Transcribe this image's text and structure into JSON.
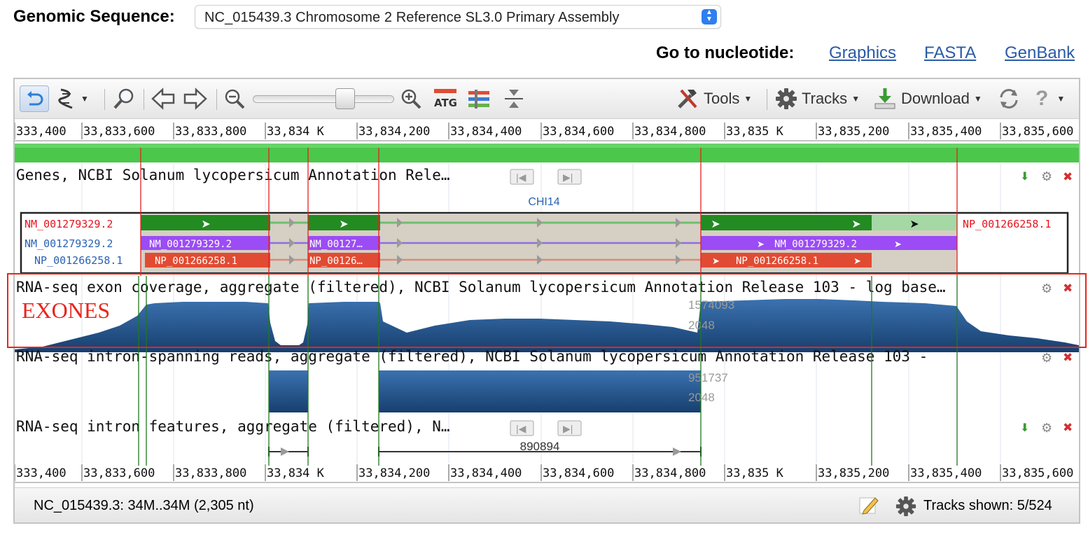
{
  "header": {
    "sequence_label": "Genomic Sequence:",
    "sequence_value": "NC_015439.3 Chromosome 2 Reference SL3.0 Primary Assembly",
    "goto_label": "Go to nucleotide:",
    "links": [
      "Graphics",
      "FASTA",
      "GenBank"
    ]
  },
  "toolbar": {
    "tools_label": "Tools",
    "tracks_label": "Tracks",
    "download_label": "Download",
    "zoom_level": 0.68
  },
  "ruler": {
    "ticks": [
      "33,833,400",
      "33,833,600",
      "33,833,800",
      "33,834 K",
      "33,834,200",
      "33,834,400",
      "33,834,600",
      "33,834,800",
      "33,835 K",
      "33,835,200",
      "33,835,400",
      "33,835,600"
    ],
    "first_tick_visible": "333,400"
  },
  "tracks": {
    "genes": {
      "title": "Genes, NCBI Solanum lycopersicum Annotation Rele…",
      "gene_name": "CHI14",
      "rows": [
        {
          "left_label": "NM_001279329.2",
          "right_label": "NP_001266258.1",
          "color": "#e8121c"
        },
        {
          "left_label": "NM_001279329.2",
          "feature_labels": [
            "NM_001279329.2",
            "NM_00127…",
            "NM_001279329.2"
          ],
          "color": "#9b4cf5"
        },
        {
          "left_label": "NP_001266258.1",
          "feature_labels": [
            "NP_001266258.1",
            "NP_00126…",
            "NP_001266258.1"
          ],
          "color": "#e14b33"
        }
      ]
    },
    "exon_coverage": {
      "title": "RNA-seq exon coverage, aggregate (filtered), NCBI Solanum lycopersicum Annotation Release 103 - log base…",
      "max_value": "1574093",
      "mid_value": "2048"
    },
    "intron_reads": {
      "title": "RNA-seq intron-spanning reads, aggregate (filtered), NCBI Solanum lycopersicum Annotation Release 103 -",
      "max_value": "951737",
      "mid_value": "2048"
    },
    "intron_features": {
      "title": "RNA-seq intron features, aggregate (filtered), N…",
      "count_label": "890894"
    }
  },
  "annotation": {
    "label": "EXONES",
    "color": "#e8251d"
  },
  "status": {
    "range": "NC_015439.3: 34M..34M (2,305 nt)",
    "tracks_shown": "Tracks shown: 5/524"
  },
  "colors": {
    "gene_green": "#228b22",
    "gene_light_green": "#a4d8a4",
    "coverage_blue": "#1f5a96",
    "link_blue": "#2a5ba6",
    "ruler_green": "#49c449",
    "marker_red": "#e41f1f",
    "marker_green": "#1d7a1d"
  },
  "icons": [
    "undo-icon",
    "dna-icon",
    "search-icon",
    "arrow-left-icon",
    "arrow-right-icon",
    "zoom-out-icon",
    "zoom-in-icon",
    "sequence-atg-icon",
    "tracks-compare-icon",
    "collapse-icon",
    "tools-icon",
    "gear-icon",
    "download-icon",
    "refresh-icon",
    "help-icon",
    "edit-icon"
  ]
}
